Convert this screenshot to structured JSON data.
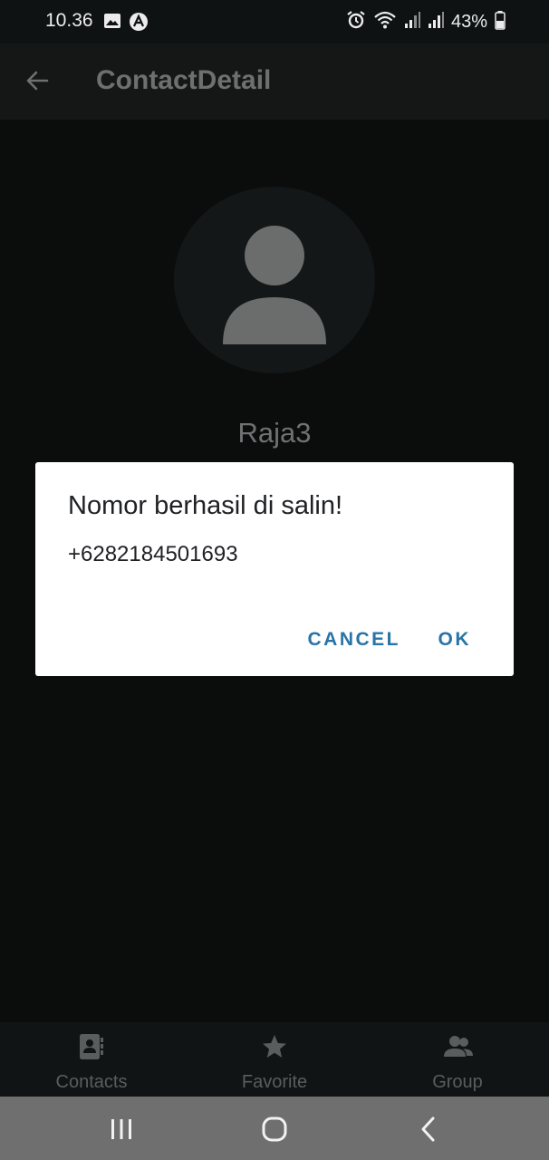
{
  "status_bar": {
    "time": "10.36",
    "battery": "43%",
    "icons": [
      "image-icon",
      "app-notification-icon",
      "alarm-icon",
      "wifi-icon",
      "signal-icon",
      "signal-icon",
      "battery-icon"
    ]
  },
  "app_bar": {
    "title": "ContactDetail",
    "back_icon": "arrow-left-icon"
  },
  "contact": {
    "name": "Raja3",
    "avatar_icon": "person-icon"
  },
  "dialog": {
    "title": "Nomor berhasil di salin!",
    "message": "+6282184501693",
    "cancel_label": "CANCEL",
    "ok_label": "OK",
    "accent_color": "#2874a6"
  },
  "bottom_nav": {
    "items": [
      {
        "label": "Contacts",
        "icon": "contacts-icon"
      },
      {
        "label": "Favorite",
        "icon": "star-icon"
      },
      {
        "label": "Group",
        "icon": "group-icon"
      }
    ]
  },
  "system_nav": {
    "buttons": [
      "recent-apps-icon",
      "home-icon",
      "back-chevron-icon"
    ]
  }
}
